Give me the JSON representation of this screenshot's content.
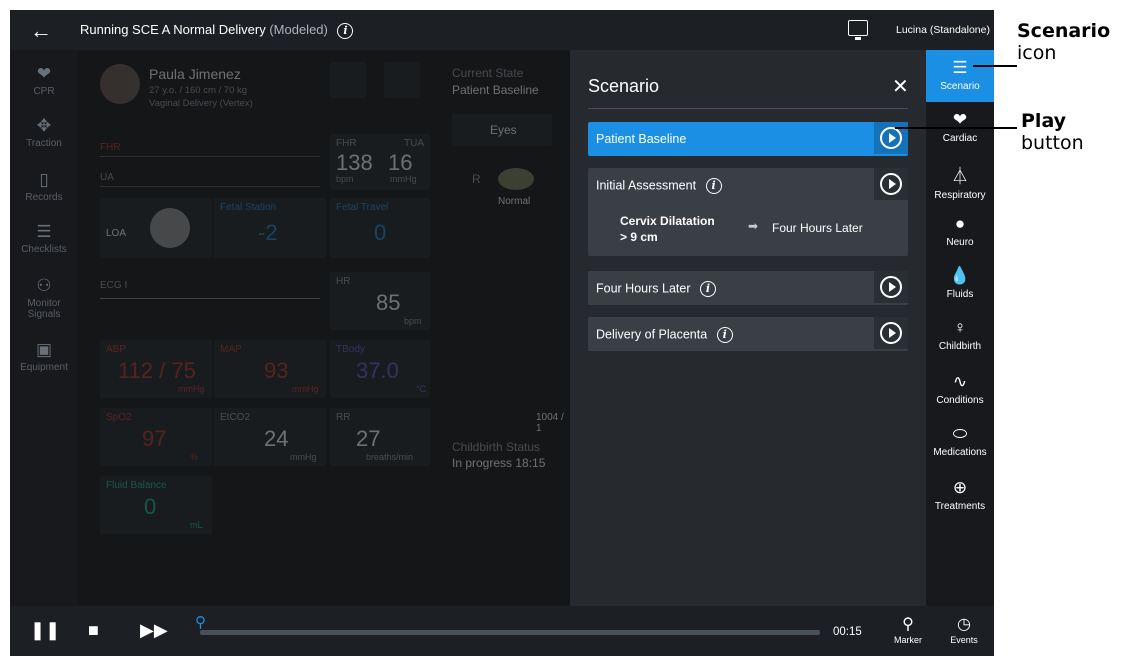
{
  "topbar": {
    "title_main": "Running SCE  A Normal Delivery",
    "title_mod": "(Modeled)",
    "user": "Lucina (Standalone)"
  },
  "left_nav": [
    {
      "label": "CPR",
      "icon": "heart-pulse-icon"
    },
    {
      "label": "Traction",
      "icon": "traction-icon"
    },
    {
      "label": "Records",
      "icon": "clipboard-icon"
    },
    {
      "label": "Checklists",
      "icon": "checklist-icon"
    },
    {
      "label": "Monitor Signals",
      "icon": "monitor-signals-icon"
    },
    {
      "label": "Equipment",
      "icon": "equipment-icon"
    }
  ],
  "patient": {
    "name": "Paula Jimenez",
    "details": "27 y.o. / 160 cm / 70 kg",
    "delivery": "Vaginal Delivery (Vertex)"
  },
  "current_state": {
    "label": "Current State",
    "value": "Patient Baseline"
  },
  "eyes": {
    "tab": "Eyes",
    "side": "R",
    "state": "Normal"
  },
  "vitals": {
    "fhr_label": "FHR",
    "ua_label": "UA",
    "fhr_tua_fhr_label": "FHR",
    "fhr_tua_tua_label": "TUA",
    "fhr_value": "138",
    "fhr_unit": "bpm",
    "tua_value": "16",
    "tua_unit": "mmHg",
    "loa": "LOA",
    "fetal_station_label": "Fetal Station",
    "fetal_station_value": "-2",
    "fetal_travel_label": "Fetal Travel",
    "fetal_travel_value": "0",
    "ecg_label": "ECG I",
    "hr_label": "HR",
    "hr_value": "85",
    "hr_unit": "bpm",
    "abp_label": "ABP",
    "abp_value": "112 / 75",
    "abp_unit": "mmHg",
    "map_label": "MAP",
    "map_value": "93",
    "map_unit": "mmHg",
    "tbody_label": "TBody",
    "tbody_value": "37.0",
    "tbody_unit": "°C",
    "spo2_label": "SpO2",
    "spo2_value": "97",
    "spo2_unit": "%",
    "etco2_label": "EtCO2",
    "etco2_value": "24",
    "etco2_unit": "mmHg",
    "rr_label": "RR",
    "rr_value": "27",
    "rr_unit": "breaths/min",
    "fluid_label": "Fluid Balance",
    "fluid_value": "0",
    "fluid_unit": "mL",
    "counter": "1004 / 1",
    "childbirth_status_label": "Childbirth Status",
    "childbirth_status_value": "In progress 18:15"
  },
  "scenario": {
    "title": "Scenario",
    "close": "✕",
    "steps": [
      {
        "name": "Patient Baseline"
      },
      {
        "name": "Initial Assessment"
      },
      {
        "name": "Four Hours Later"
      },
      {
        "name": "Delivery of Placenta"
      }
    ],
    "condition_line1": "Cervix Dilatation",
    "condition_line2": "> 9 cm",
    "condition_target": "Four Hours Later"
  },
  "right_nav": [
    {
      "label": "Scenario",
      "icon": "list-icon"
    },
    {
      "label": "Cardiac",
      "icon": "heart-icon"
    },
    {
      "label": "Respiratory",
      "icon": "lungs-icon"
    },
    {
      "label": "Neuro",
      "icon": "brain-icon"
    },
    {
      "label": "Fluids",
      "icon": "drop-icon"
    },
    {
      "label": "Childbirth",
      "icon": "pregnant-icon"
    },
    {
      "label": "Conditions",
      "icon": "pulse-icon"
    },
    {
      "label": "Medications",
      "icon": "pill-icon"
    },
    {
      "label": "Treatments",
      "icon": "first-aid-icon"
    }
  ],
  "bottom": {
    "time": "00:15",
    "marker_label": "Marker",
    "events_label": "Events"
  },
  "annotations": {
    "scenario_bold": "Scenario",
    "scenario_rest": "icon",
    "play_bold": "Play",
    "play_rest": "button"
  },
  "colors": {
    "accent": "#1a8fe3",
    "background": "#0d0f11",
    "panel": "#262a2f"
  }
}
